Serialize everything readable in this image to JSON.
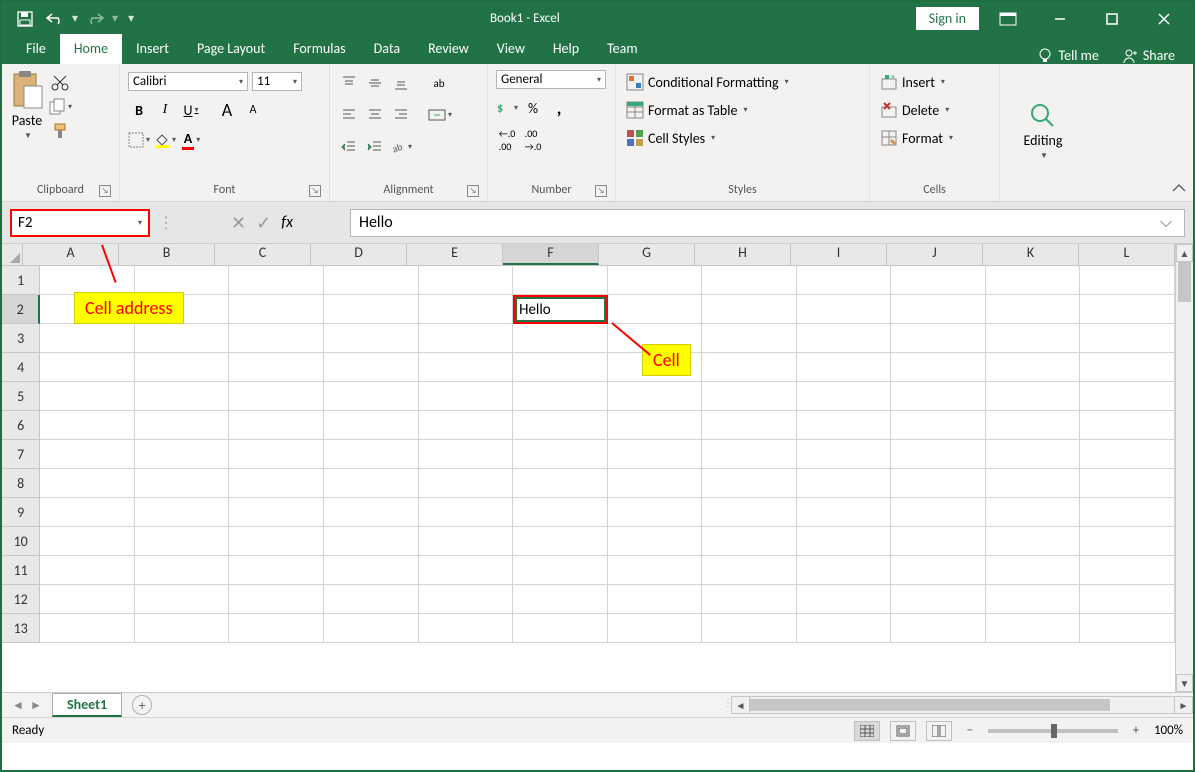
{
  "title": "Book1  -  Excel",
  "signin": "Sign in",
  "tabs": {
    "file": "File",
    "home": "Home",
    "insert": "Insert",
    "pagelayout": "Page Layout",
    "formulas": "Formulas",
    "data": "Data",
    "review": "Review",
    "view": "View",
    "help": "Help",
    "team": "Team",
    "tellme": "Tell me",
    "share": "Share"
  },
  "ribbon": {
    "clipboard": {
      "label": "Clipboard",
      "paste": "Paste"
    },
    "font": {
      "label": "Font",
      "name": "Calibri",
      "size": "11",
      "bold": "B",
      "italic": "I",
      "underline": "U",
      "incA": "A",
      "decA": "A"
    },
    "alignment": {
      "label": "Alignment",
      "wrap": "ab"
    },
    "number": {
      "label": "Number",
      "format": "General",
      "pct": "%",
      "comma": ",",
      "incdec1": ".0",
      "incdec2": ".00"
    },
    "styles": {
      "label": "Styles",
      "cond": "Conditional Formatting",
      "table": "Format as Table",
      "cell": "Cell Styles"
    },
    "cells": {
      "label": "Cells",
      "insert": "Insert",
      "delete": "Delete",
      "format": "Format"
    },
    "editing": {
      "label": "Editing"
    }
  },
  "namebox": "F2",
  "fx": "fx",
  "formula": "Hello",
  "columns": [
    "A",
    "B",
    "C",
    "D",
    "E",
    "F",
    "G",
    "H",
    "I",
    "J",
    "K",
    "L"
  ],
  "rows": [
    "1",
    "2",
    "3",
    "4",
    "5",
    "6",
    "7",
    "8",
    "9",
    "10",
    "11",
    "12",
    "13"
  ],
  "activeCell": {
    "col": "F",
    "row": "2",
    "value": "Hello"
  },
  "annot": {
    "addr": "Cell address",
    "cell": "Cell"
  },
  "sheet": "Sheet1",
  "status": "Ready",
  "zoom": "100%"
}
